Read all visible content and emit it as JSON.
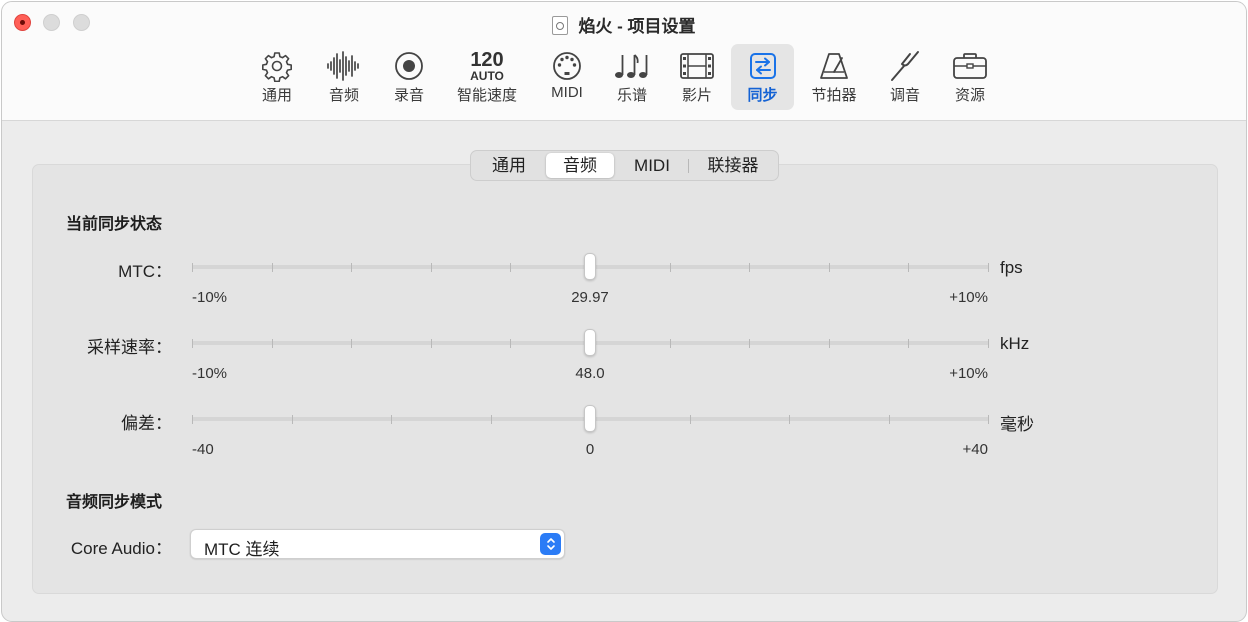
{
  "window": {
    "title": "焰火 - 项目设置"
  },
  "toolbar": {
    "items": [
      {
        "label": "通用",
        "icon": "gear-icon"
      },
      {
        "label": "音频",
        "icon": "waveform-icon"
      },
      {
        "label": "录音",
        "icon": "record-icon"
      },
      {
        "label": "智能速度",
        "icon": "tempo-icon",
        "icon_text_top": "120",
        "icon_text_bottom": "AUTO"
      },
      {
        "label": "MIDI",
        "icon": "midi-connector-icon"
      },
      {
        "label": "乐谱",
        "icon": "music-notes-icon"
      },
      {
        "label": "影片",
        "icon": "film-strip-icon"
      },
      {
        "label": "同步",
        "icon": "sync-arrows-icon",
        "active": true
      },
      {
        "label": "节拍器",
        "icon": "metronome-icon"
      },
      {
        "label": "调音",
        "icon": "tuning-fork-icon"
      },
      {
        "label": "资源",
        "icon": "briefcase-icon"
      }
    ]
  },
  "subtabs": {
    "items": [
      "通用",
      "音频",
      "MIDI",
      "联接器"
    ],
    "selected": "音频"
  },
  "sync_status": {
    "title": "当前同步状态",
    "rows": [
      {
        "label": "MTC：",
        "unit": "fps",
        "min": "-10%",
        "center": "29.97",
        "max": "+10%",
        "position": 0.5
      },
      {
        "label": "采样速率：",
        "unit": "kHz",
        "min": "-10%",
        "center": "48.0",
        "max": "+10%",
        "position": 0.5
      },
      {
        "label": "偏差：",
        "unit": "毫秒",
        "min": "-40",
        "center": "0",
        "max": "+40",
        "position": 0.5
      }
    ]
  },
  "audio_sync_mode": {
    "title": "音频同步模式",
    "label": "Core Audio：",
    "value": "MTC 连续"
  },
  "colors": {
    "accent": "#2b7cf6",
    "active_label": "#1462d4",
    "close": "#ff5f57"
  }
}
